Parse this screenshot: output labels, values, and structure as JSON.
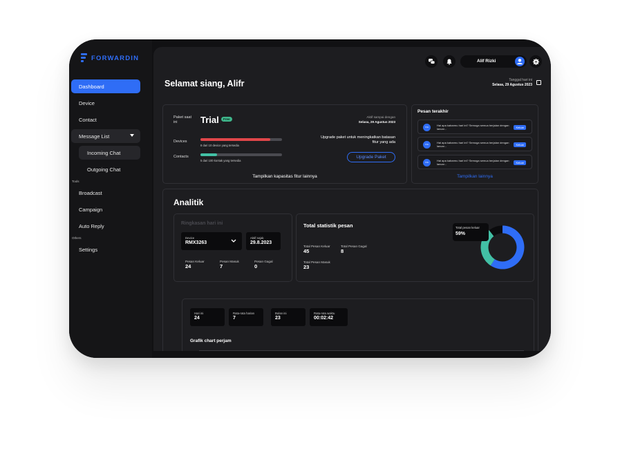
{
  "brand": {
    "name": "FORWARDIN",
    "accent": "#2f6df6",
    "teal": "#42c0a5",
    "red": "#e0464a"
  },
  "sidebar": {
    "items": [
      {
        "label": "Dashboard"
      },
      {
        "label": "Device"
      },
      {
        "label": "Contact"
      },
      {
        "label": "Message List"
      },
      {
        "label": "Incoming Chat"
      },
      {
        "label": "Outgoing Chat"
      },
      {
        "label": "Broadcast"
      },
      {
        "label": "Campaign"
      },
      {
        "label": "Auto Reply"
      },
      {
        "label": "Settings"
      }
    ],
    "sections": {
      "tools": "Tools",
      "others": "Others"
    }
  },
  "topbar": {
    "user_name": "Alif Rizki",
    "icons": [
      "chat-icon",
      "bell-icon",
      "user-icon",
      "gear-icon"
    ]
  },
  "header": {
    "greeting": "Selamat siang, Alifr",
    "date_label": "Tanggal hari ini",
    "date_value": "Selasa, 29 Agustus 2023"
  },
  "plan": {
    "label": "Paket saat ini",
    "name": "Trial",
    "badge": "Free",
    "active_label": "Aktif sampai dengan",
    "active_until": "Selasa, 29 Agustus 2023",
    "devices_label": "Devices",
    "devices_note": "8 dari 10 device yang tersedia",
    "devices_ratio": 0.86,
    "contacts_label": "Contacts",
    "contacts_note": "5 dari 100 kontak yang tersedia",
    "contacts_ratio": 0.2,
    "upgrade_text": "Upgrade paket untuk meningkatkan batasan fitur yang ada",
    "upgrade_button": "Upgrade Paket",
    "more_features": "Tampilkan kapasitas fitur lainnya"
  },
  "recent": {
    "title": "Pesan terakhir",
    "messages": [
      {
        "avatar": "YOU",
        "text": "Hai apa kabarmu hari ini? Semoga semua berjalan dengan lancar...",
        "badge": "Keluar"
      },
      {
        "avatar": "YOU",
        "text": "Hai apa kabarmu hari ini? Semoga semua berjalan dengan lancar...",
        "badge": "Keluar"
      },
      {
        "avatar": "YOU",
        "text": "Hai apa kabarmu hari ini? Semoga semua berjalan dengan lancar...",
        "badge": "Keluar"
      }
    ],
    "more": "Tampilkan lainnya"
  },
  "analytics": {
    "title": "Analitik",
    "summary": {
      "title": "Ringkasan hari ini",
      "device_label": "Device",
      "device_value": "RMX3263",
      "active_label": "Aktif sejak",
      "active_value": "29.8.2023",
      "stats": [
        {
          "label": "Pesan Keluar",
          "value": "24"
        },
        {
          "label": "Pesan Masuk",
          "value": "7"
        },
        {
          "label": "Pesan Gagal",
          "value": "0"
        }
      ]
    },
    "total": {
      "title": "Total statistik pesan",
      "stats": [
        {
          "label": "Total Pesan Keluar",
          "value": "45"
        },
        {
          "label": "Total Pesan Gagal",
          "value": "8"
        },
        {
          "label": "Total Pesan Masuk",
          "value": "23"
        }
      ],
      "tooltip_label": "Total pesan keluar",
      "tooltip_value": "59%"
    },
    "tiles": [
      {
        "label": "Hari ini",
        "value": "24"
      },
      {
        "label": "Rata-rata harian",
        "value": "7"
      },
      {
        "label": "Bulan ini",
        "value": "23"
      },
      {
        "label": "Rata-rata waktu",
        "value": "00:02:42"
      }
    ],
    "hourly_chart_title": "Grafik chart perjam"
  },
  "chart_data": {
    "type": "pie",
    "categories": [
      "Total Pesan Keluar",
      "Total Pesan Masuk",
      "Total Pesan Gagal"
    ],
    "values": [
      45,
      23,
      8
    ],
    "colors": [
      "#2f6df6",
      "#42c0a5",
      "#0b0b0d"
    ]
  }
}
